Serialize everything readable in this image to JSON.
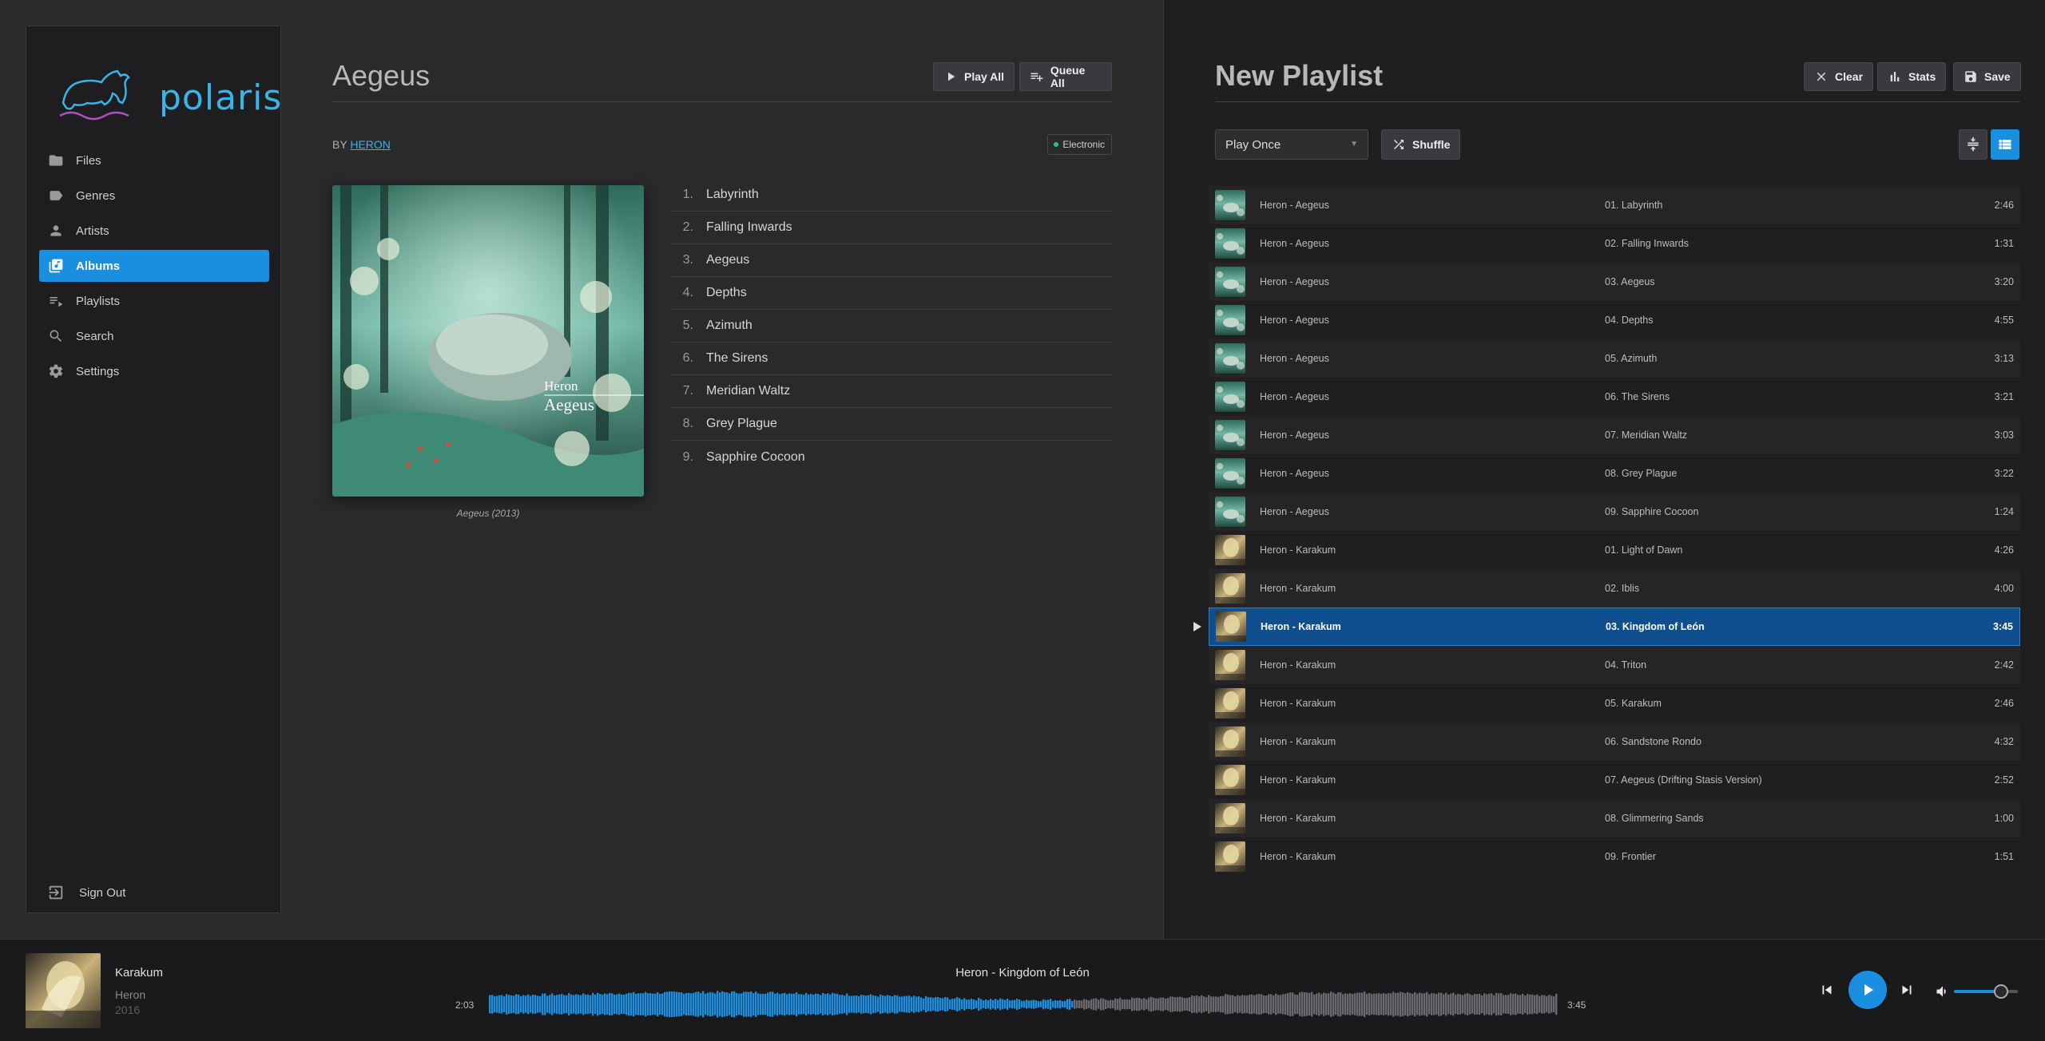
{
  "app": {
    "name": "polaris"
  },
  "sidebar": {
    "items": [
      {
        "label": "Files",
        "icon": "folder-icon",
        "active": false
      },
      {
        "label": "Genres",
        "icon": "label-icon",
        "active": false
      },
      {
        "label": "Artists",
        "icon": "person-icon",
        "active": false
      },
      {
        "label": "Albums",
        "icon": "album-icon",
        "active": true
      },
      {
        "label": "Playlists",
        "icon": "playlist-icon",
        "active": false
      },
      {
        "label": "Search",
        "icon": "search-icon",
        "active": false
      },
      {
        "label": "Settings",
        "icon": "gear-icon",
        "active": false
      }
    ],
    "sign_out": "Sign Out"
  },
  "album": {
    "title": "Aegeus",
    "play_all": "Play All",
    "queue_all": "Queue All",
    "by_prefix": "BY",
    "artist": "HERON",
    "genre": "Electronic",
    "cover_text_artist": "Heron",
    "cover_text_title": "Aegeus",
    "caption": "Aegeus (2013)",
    "tracks": [
      {
        "num": "1.",
        "title": "Labyrinth"
      },
      {
        "num": "2.",
        "title": "Falling Inwards"
      },
      {
        "num": "3.",
        "title": "Aegeus"
      },
      {
        "num": "4.",
        "title": "Depths"
      },
      {
        "num": "5.",
        "title": "Azimuth"
      },
      {
        "num": "6.",
        "title": "The Sirens"
      },
      {
        "num": "7.",
        "title": "Meridian Waltz"
      },
      {
        "num": "8.",
        "title": "Grey Plague"
      },
      {
        "num": "9.",
        "title": "Sapphire Cocoon"
      }
    ]
  },
  "playlist": {
    "title": "New Playlist",
    "clear": "Clear",
    "stats": "Stats",
    "save": "Save",
    "mode": "Play Once",
    "shuffle": "Shuffle",
    "rows": [
      {
        "artist": "Heron - Aegeus",
        "track": "01. Labyrinth",
        "duration": "2:46",
        "cover": "forest"
      },
      {
        "artist": "Heron - Aegeus",
        "track": "02. Falling Inwards",
        "duration": "1:31",
        "cover": "forest"
      },
      {
        "artist": "Heron - Aegeus",
        "track": "03. Aegeus",
        "duration": "3:20",
        "cover": "forest"
      },
      {
        "artist": "Heron - Aegeus",
        "track": "04. Depths",
        "duration": "4:55",
        "cover": "forest"
      },
      {
        "artist": "Heron - Aegeus",
        "track": "05. Azimuth",
        "duration": "3:13",
        "cover": "forest"
      },
      {
        "artist": "Heron - Aegeus",
        "track": "06. The Sirens",
        "duration": "3:21",
        "cover": "forest"
      },
      {
        "artist": "Heron - Aegeus",
        "track": "07. Meridian Waltz",
        "duration": "3:03",
        "cover": "forest"
      },
      {
        "artist": "Heron - Aegeus",
        "track": "08. Grey Plague",
        "duration": "3:22",
        "cover": "forest"
      },
      {
        "artist": "Heron - Aegeus",
        "track": "09. Sapphire Cocoon",
        "duration": "1:24",
        "cover": "forest"
      },
      {
        "artist": "Heron - Karakum",
        "track": "01. Light of Dawn",
        "duration": "4:26",
        "cover": "desert"
      },
      {
        "artist": "Heron - Karakum",
        "track": "02. Iblis",
        "duration": "4:00",
        "cover": "desert"
      },
      {
        "artist": "Heron - Karakum",
        "track": "03. Kingdom of León",
        "duration": "3:45",
        "cover": "desert",
        "current": true
      },
      {
        "artist": "Heron - Karakum",
        "track": "04. Triton",
        "duration": "2:42",
        "cover": "desert"
      },
      {
        "artist": "Heron - Karakum",
        "track": "05. Karakum",
        "duration": "2:46",
        "cover": "desert"
      },
      {
        "artist": "Heron - Karakum",
        "track": "06. Sandstone Rondo",
        "duration": "4:32",
        "cover": "desert"
      },
      {
        "artist": "Heron - Karakum",
        "track": "07. Aegeus (Drifting Stasis Version)",
        "duration": "2:52",
        "cover": "desert"
      },
      {
        "artist": "Heron - Karakum",
        "track": "08. Glimmering Sands",
        "duration": "1:00",
        "cover": "desert"
      },
      {
        "artist": "Heron - Karakum",
        "track": "09. Frontier",
        "duration": "1:51",
        "cover": "desert"
      }
    ]
  },
  "player": {
    "album": "Karakum",
    "artist": "Heron",
    "year": "2016",
    "now_playing": "Heron - Kingdom of León",
    "elapsed": "2:03",
    "total": "3:45",
    "progress": 0.547,
    "volume": 0.75
  },
  "colors": {
    "accent": "#1a8fe0",
    "current_row": "#0f4f8f",
    "logo": "#3ab3e8"
  }
}
